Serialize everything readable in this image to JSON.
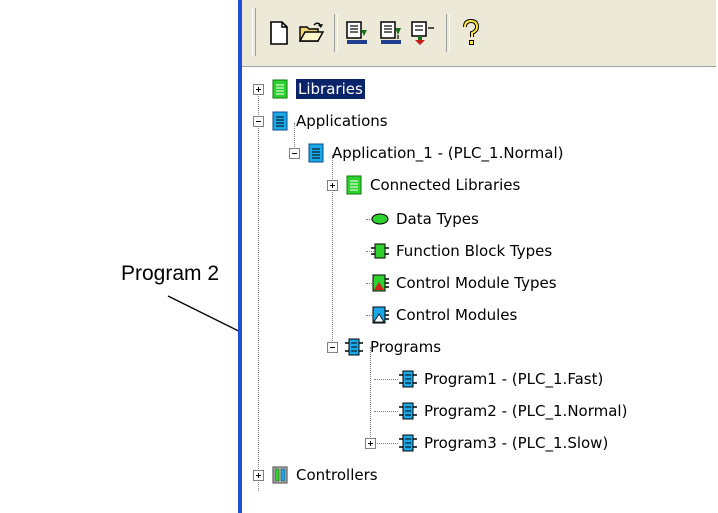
{
  "callout": {
    "label": "Program 2"
  },
  "toolbar": {
    "buttons": [
      "new-icon",
      "open-icon",
      "download-icon",
      "download-all-icon",
      "download-project-icon",
      "help-icon"
    ]
  },
  "tree": {
    "libraries": "Libraries",
    "applications": "Applications",
    "application_1": "Application_1 - (PLC_1.Normal)",
    "connected_libraries": "Connected Libraries",
    "data_types": "Data Types",
    "function_block_types": "Function Block Types",
    "control_module_types": "Control Module Types",
    "control_modules": "Control Modules",
    "programs": "Programs",
    "program1": "Program1 - (PLC_1.Fast)",
    "program2": "Program2 - (PLC_1.Normal)",
    "program3": "Program3 - (PLC_1.Slow)",
    "controllers": "Controllers"
  },
  "colors": {
    "selection": "#0a246a",
    "library_green": "#2fd12f",
    "app_blue": "#19a9e8",
    "window_border": "#1f4fd6"
  }
}
